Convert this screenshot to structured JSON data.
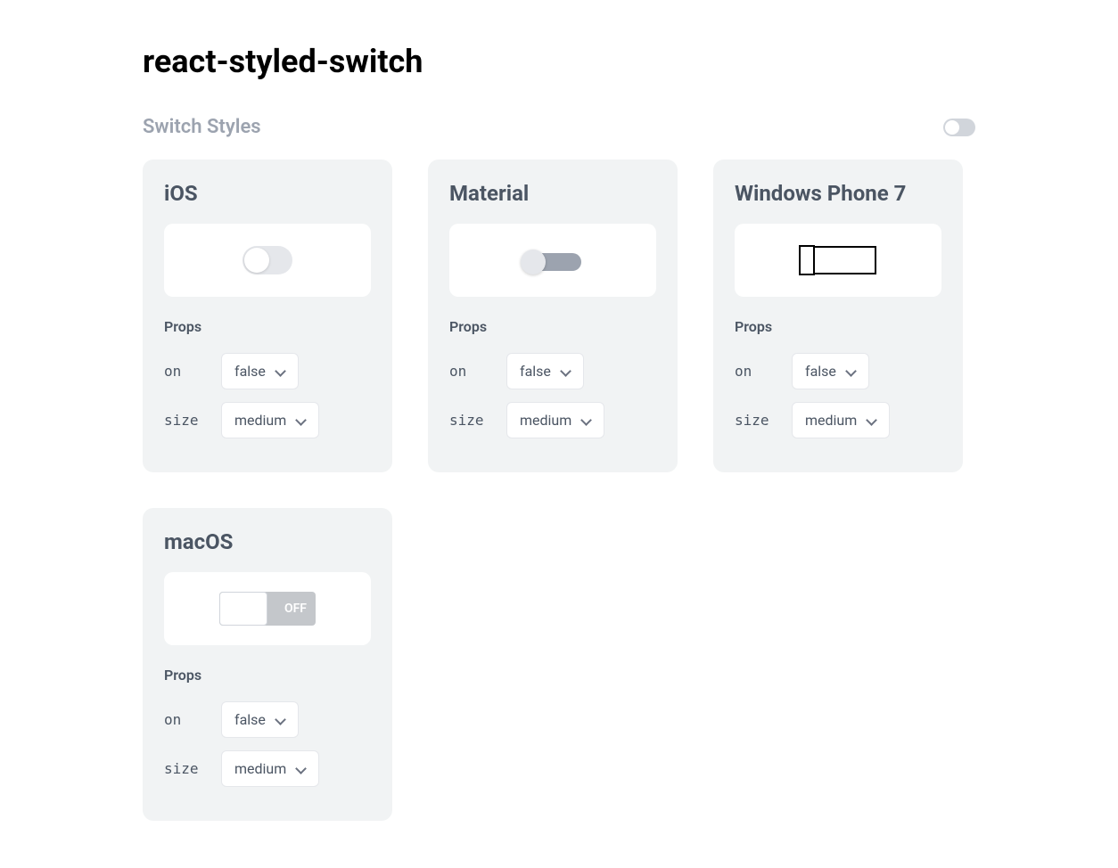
{
  "page": {
    "title": "react-styled-switch",
    "section_title": "Switch Styles"
  },
  "props_heading": "Props",
  "cards": [
    {
      "title": "iOS",
      "on_label": "on",
      "on_value": "false",
      "size_label": "size",
      "size_value": "medium"
    },
    {
      "title": "Material",
      "on_label": "on",
      "on_value": "false",
      "size_label": "size",
      "size_value": "medium"
    },
    {
      "title": "Windows Phone 7",
      "on_label": "on",
      "on_value": "false",
      "size_label": "size",
      "size_value": "medium"
    },
    {
      "title": "macOS",
      "off_text": "OFF",
      "on_label": "on",
      "on_value": "false",
      "size_label": "size",
      "size_value": "medium"
    }
  ]
}
